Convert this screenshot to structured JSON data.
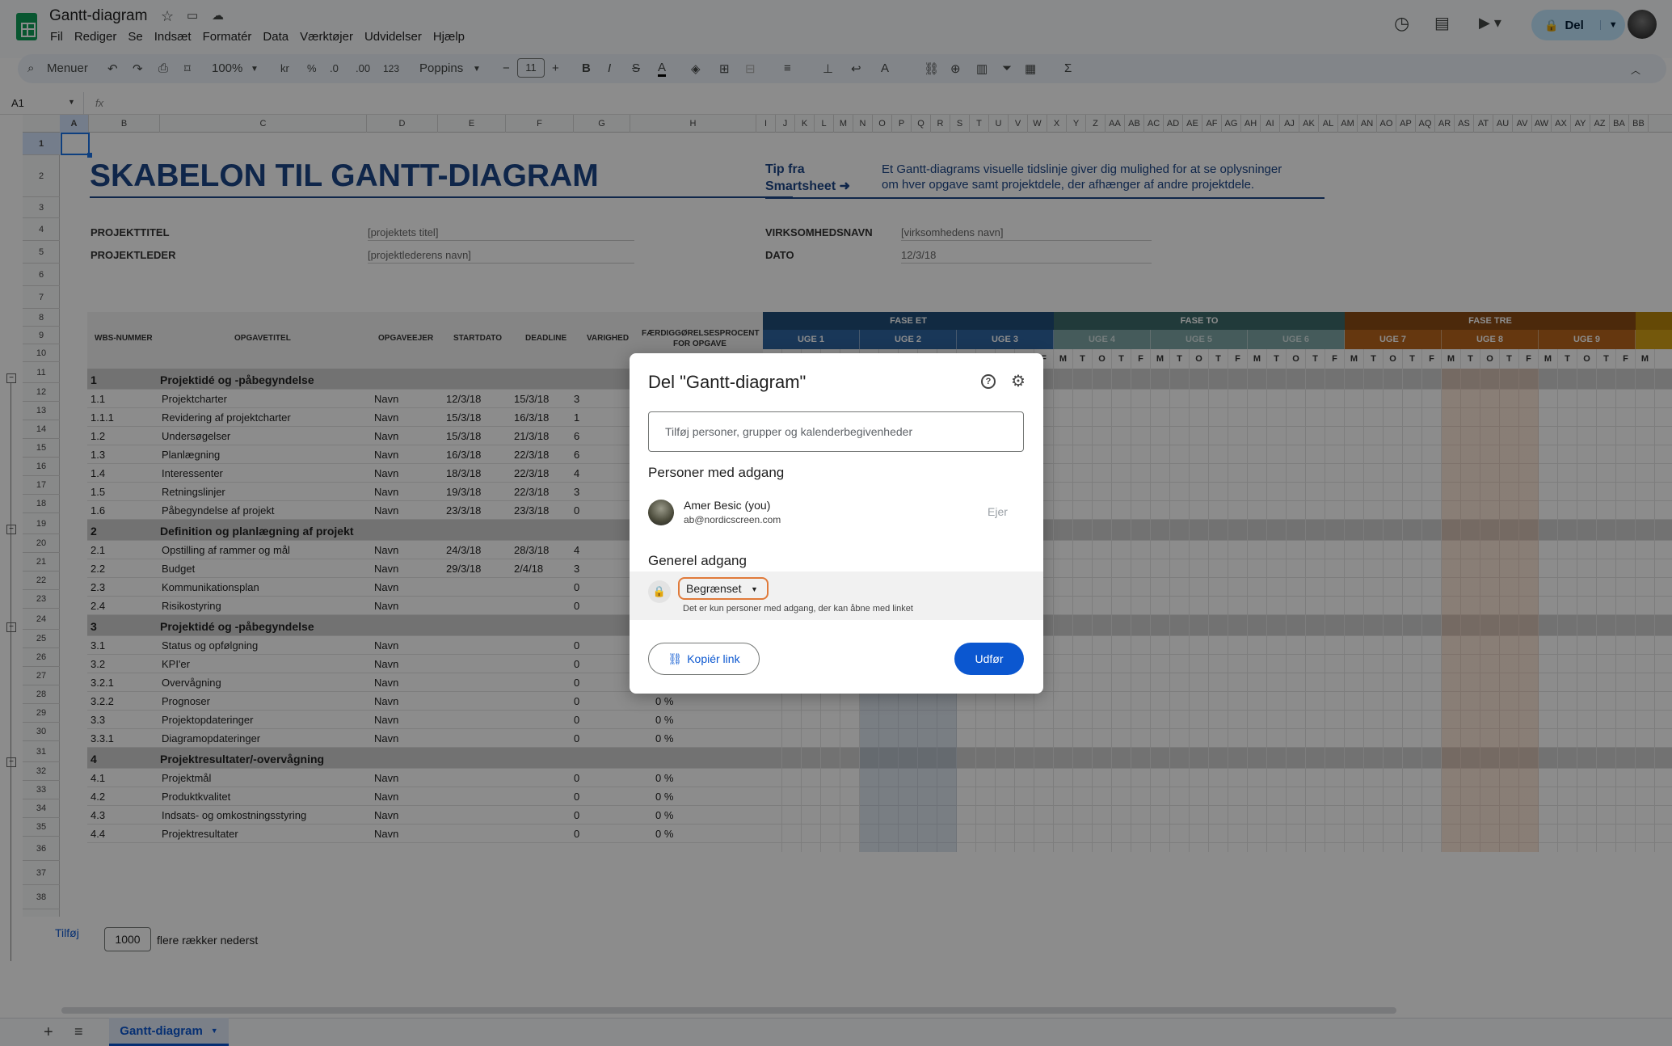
{
  "header": {
    "doc_title": "Gantt-diagram",
    "menu": [
      "Fil",
      "Rediger",
      "Se",
      "Indsæt",
      "Formatér",
      "Data",
      "Værktøjer",
      "Udvidelser",
      "Hjælp"
    ],
    "share_label": "Del"
  },
  "toolbar": {
    "menus_label": "Menuer",
    "zoom": "100%",
    "currency": "kr",
    "percent": "%",
    "dec_minus": ".0",
    "dec_plus": ".00",
    "num_format": "123",
    "font": "Poppins",
    "font_size": "11",
    "bold": "B",
    "italic": "I",
    "strike": "S",
    "text_color": "A",
    "sum": "Σ"
  },
  "formula_bar": {
    "cell_ref": "A1",
    "fx": "fx"
  },
  "columns": [
    "A",
    "B",
    "C",
    "D",
    "E",
    "F",
    "G",
    "H",
    "I",
    "J",
    "K",
    "L",
    "M",
    "N",
    "O",
    "P",
    "Q",
    "R",
    "S",
    "T",
    "U",
    "V",
    "W",
    "X",
    "Y",
    "Z",
    "AA",
    "AB",
    "AC",
    "AD",
    "AE",
    "AF",
    "AG",
    "AH",
    "AI",
    "AJ",
    "AK",
    "AL",
    "AM",
    "AN",
    "AO",
    "AP",
    "AQ",
    "AR",
    "AS",
    "AT",
    "AU",
    "AV",
    "AW",
    "AX",
    "AY",
    "AZ",
    "BA",
    "BB"
  ],
  "rows": [
    "1",
    "2",
    "3",
    "4",
    "5",
    "6",
    "7",
    "8",
    "9",
    "10",
    "11",
    "12",
    "13",
    "14",
    "15",
    "16",
    "17",
    "18",
    "19",
    "20",
    "21",
    "22",
    "23",
    "24",
    "25",
    "26",
    "27",
    "28",
    "29",
    "30",
    "31",
    "32",
    "33",
    "34",
    "35",
    "36",
    "37",
    "38"
  ],
  "sheet": {
    "main_title": "SKABELON TIL GANTT-DIAGRAM",
    "tip_line1": "Tip fra",
    "tip_line2": "Smartsheet ➜",
    "tip_text1": "Et Gantt-diagrams visuelle tidslinje giver dig mulighed for at se oplysninger",
    "tip_text2": "om hver opgave samt projektdele, der afhænger af andre projektdele.",
    "project_title_label": "PROJEKTTITEL",
    "project_title_value": "[projektets titel]",
    "project_lead_label": "PROJEKTLEDER",
    "project_lead_value": "[projektlederens navn]",
    "company_label": "VIRKSOMHEDSNAVN",
    "company_value": "[virksomhedens navn]",
    "date_label": "DATO",
    "date_value": "12/3/18",
    "col_headers": {
      "wbs": "WBS-NUMMER",
      "task": "OPGAVETITEL",
      "owner": "OPGAVEEJER",
      "start": "STARTDATO",
      "deadline": "DEADLINE",
      "duration": "VARIGHED",
      "pct1": "FÆRDIGGØRELSESPROCENT",
      "pct2": "FOR OPGAVE"
    },
    "phases": [
      "FASE ET",
      "FASE TO",
      "FASE TRE"
    ],
    "weeks": [
      "UGE 1",
      "UGE 2",
      "UGE 3",
      "UGE 4",
      "UGE 5",
      "UGE 6",
      "UGE 7",
      "UGE 8",
      "UGE 9"
    ],
    "days": [
      "M",
      "T",
      "O",
      "T",
      "F",
      "M",
      "T",
      "O",
      "T",
      "F",
      "M",
      "T",
      "O",
      "T",
      "F",
      "M",
      "T",
      "O",
      "T",
      "F",
      "M",
      "T",
      "O",
      "T",
      "F",
      "M",
      "T",
      "O",
      "T",
      "F",
      "M",
      "T",
      "O",
      "T",
      "F",
      "M",
      "T",
      "O",
      "T",
      "F",
      "M",
      "T",
      "O",
      "T",
      "F",
      "M"
    ],
    "tasks": [
      {
        "row": 11,
        "wbs": "1",
        "title": "Projektidé og -påbegyndelse",
        "owner": "",
        "start": "",
        "deadline": "",
        "dur": "",
        "pct": "",
        "section": true
      },
      {
        "row": 12,
        "wbs": "1.1",
        "title": "Projektcharter",
        "owner": "Navn",
        "start": "12/3/18",
        "deadline": "15/3/18",
        "dur": "3",
        "pct": ""
      },
      {
        "row": 13,
        "wbs": "1.1.1",
        "title": "Revidering af projektcharter",
        "owner": "Navn",
        "start": "15/3/18",
        "deadline": "16/3/18",
        "dur": "1",
        "pct": ""
      },
      {
        "row": 14,
        "wbs": "1.2",
        "title": "Undersøgelser",
        "owner": "Navn",
        "start": "15/3/18",
        "deadline": "21/3/18",
        "dur": "6",
        "pct": ""
      },
      {
        "row": 15,
        "wbs": "1.3",
        "title": "Planlægning",
        "owner": "Navn",
        "start": "16/3/18",
        "deadline": "22/3/18",
        "dur": "6",
        "pct": ""
      },
      {
        "row": 16,
        "wbs": "1.4",
        "title": "Interessenter",
        "owner": "Navn",
        "start": "18/3/18",
        "deadline": "22/3/18",
        "dur": "4",
        "pct": ""
      },
      {
        "row": 17,
        "wbs": "1.5",
        "title": "Retningslinjer",
        "owner": "Navn",
        "start": "19/3/18",
        "deadline": "22/3/18",
        "dur": "3",
        "pct": ""
      },
      {
        "row": 18,
        "wbs": "1.6",
        "title": "Påbegyndelse af projekt",
        "owner": "Navn",
        "start": "23/3/18",
        "deadline": "23/3/18",
        "dur": "0",
        "pct": ""
      },
      {
        "row": 19,
        "wbs": "2",
        "title": "Definition og planlægning af projekt",
        "owner": "",
        "start": "",
        "deadline": "",
        "dur": "",
        "pct": "",
        "section": true
      },
      {
        "row": 20,
        "wbs": "2.1",
        "title": "Opstilling af rammer og mål",
        "owner": "Navn",
        "start": "24/3/18",
        "deadline": "28/3/18",
        "dur": "4",
        "pct": ""
      },
      {
        "row": 21,
        "wbs": "2.2",
        "title": "Budget",
        "owner": "Navn",
        "start": "29/3/18",
        "deadline": "2/4/18",
        "dur": "3",
        "pct": ""
      },
      {
        "row": 22,
        "wbs": "2.3",
        "title": "Kommunikationsplan",
        "owner": "Navn",
        "start": "",
        "deadline": "",
        "dur": "0",
        "pct": ""
      },
      {
        "row": 23,
        "wbs": "2.4",
        "title": "Risikostyring",
        "owner": "Navn",
        "start": "",
        "deadline": "",
        "dur": "0",
        "pct": ""
      },
      {
        "row": 24,
        "wbs": "3",
        "title": "Projektidé og -påbegyndelse",
        "owner": "",
        "start": "",
        "deadline": "",
        "dur": "",
        "pct": "",
        "section": true
      },
      {
        "row": 25,
        "wbs": "3.1",
        "title": "Status og opfølgning",
        "owner": "Navn",
        "start": "",
        "deadline": "",
        "dur": "0",
        "pct": ""
      },
      {
        "row": 26,
        "wbs": "3.2",
        "title": "KPI'er",
        "owner": "Navn",
        "start": "",
        "deadline": "",
        "dur": "0",
        "pct": ""
      },
      {
        "row": 27,
        "wbs": "3.2.1",
        "title": "Overvågning",
        "owner": "Navn",
        "start": "",
        "deadline": "",
        "dur": "0",
        "pct": ""
      },
      {
        "row": 28,
        "wbs": "3.2.2",
        "title": "Prognoser",
        "owner": "Navn",
        "start": "",
        "deadline": "",
        "dur": "0",
        "pct": "0 %"
      },
      {
        "row": 29,
        "wbs": "3.3",
        "title": "Projektopdateringer",
        "owner": "Navn",
        "start": "",
        "deadline": "",
        "dur": "0",
        "pct": "0 %"
      },
      {
        "row": 30,
        "wbs": "3.3.1",
        "title": "Diagramopdateringer",
        "owner": "Navn",
        "start": "",
        "deadline": "",
        "dur": "0",
        "pct": "0 %"
      },
      {
        "row": 31,
        "wbs": "4",
        "title": "Projektresultater/-overvågning",
        "owner": "",
        "start": "",
        "deadline": "",
        "dur": "",
        "pct": "",
        "section": true
      },
      {
        "row": 32,
        "wbs": "4.1",
        "title": "Projektmål",
        "owner": "Navn",
        "start": "",
        "deadline": "",
        "dur": "0",
        "pct": "0 %"
      },
      {
        "row": 33,
        "wbs": "4.2",
        "title": "Produktkvalitet",
        "owner": "Navn",
        "start": "",
        "deadline": "",
        "dur": "0",
        "pct": "0 %"
      },
      {
        "row": 34,
        "wbs": "4.3",
        "title": "Indsats- og omkostningsstyring",
        "owner": "Navn",
        "start": "",
        "deadline": "",
        "dur": "0",
        "pct": "0 %"
      },
      {
        "row": 35,
        "wbs": "4.4",
        "title": "Projektresultater",
        "owner": "Navn",
        "start": "",
        "deadline": "",
        "dur": "0",
        "pct": "0 %"
      }
    ]
  },
  "dialog": {
    "title": "Del \"Gantt-diagram\"",
    "input_placeholder": "Tilføj personer, grupper og kalenderbegivenheder",
    "people_heading": "Personer med adgang",
    "person_name": "Amer Besic (you)",
    "person_email": "ab@nordicscreen.com",
    "person_role": "Ejer",
    "general_heading": "Generel adgang",
    "access_value": "Begrænset",
    "access_desc": "Det er kun personer med adgang, der kan åbne med linket",
    "copy_label": "Kopiér link",
    "done_label": "Udfør"
  },
  "footer": {
    "add_label": "Tilføj",
    "rows_value": "1000",
    "rows_text": "flere rækker nederst",
    "sheet_tab": "Gantt-diagram"
  },
  "colors": {
    "phase1": "#1f4e79",
    "phase2": "#3d6b6b",
    "phase3": "#8a4b14",
    "accent": "#0b57d0",
    "title_blue": "#1c4587"
  }
}
